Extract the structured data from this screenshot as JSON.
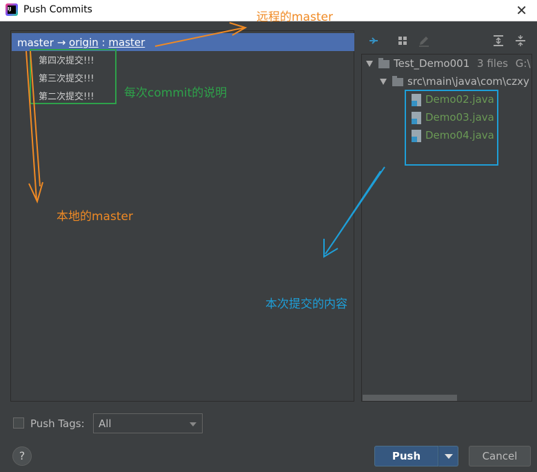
{
  "window": {
    "title": "Push Commits",
    "close_glyph": "✕"
  },
  "push_tree": {
    "local_branch": "master",
    "arrow": "→",
    "remote": "origin",
    "separator": ":",
    "remote_branch": "master",
    "commits": [
      "第四次提交!!!",
      "第三次提交!!!",
      "第二次提交!!!"
    ]
  },
  "file_tree": {
    "project": "Test_Demo001",
    "file_count": "3 files",
    "project_path": "G:\\id",
    "folder": "src\\main\\java\\com\\czxy",
    "files": [
      "Demo02.java",
      "Demo03.java",
      "Demo04.java"
    ],
    "file_color": "#6a9955"
  },
  "annotations": {
    "remote_master": "远程的master",
    "commit_desc": "每次commit的说明",
    "local_master": "本地的master",
    "commit_content": "本次提交的内容"
  },
  "footer": {
    "push_tags_label": "Push Tags:",
    "tags_select_value": "All",
    "help_glyph": "?",
    "push_label": "Push",
    "cancel_label": "Cancel"
  },
  "icons": [
    "app-icon",
    "close-icon",
    "collapse-icon",
    "group-by-icon",
    "edit-icon",
    "expand-all-icon",
    "collapse-all-icon",
    "chevron-down-icon",
    "folder-icon",
    "java-file-icon",
    "help-icon"
  ],
  "colors": {
    "selection": "#4b6eaf",
    "push_button": "#365880",
    "annot_orange": "#f08a24",
    "annot_green": "#2ea24a",
    "annot_blue": "#1e9fd8"
  }
}
